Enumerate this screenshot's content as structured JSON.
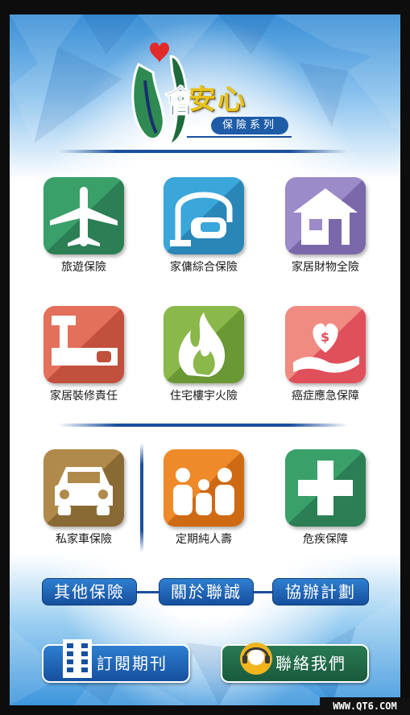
{
  "logo": {
    "title": "安心",
    "subtitle": "保險系列",
    "brand_char": "會",
    "heart_color": "#e22a2a"
  },
  "tiles": [
    {
      "label": "旅遊保險",
      "icon": "airplane-icon",
      "color_a": "#3aa06a",
      "color_b": "#2c7e54"
    },
    {
      "label": "家傭綜合保險",
      "icon": "vacuum-cleaner-icon",
      "color_a": "#3aa6d9",
      "color_b": "#2a86b7"
    },
    {
      "label": "家居財物全險",
      "icon": "house-icon",
      "color_a": "#9c8bc9",
      "color_b": "#7a68aa"
    },
    {
      "label": "家居裝修責任",
      "icon": "hammer-saw-icon",
      "color_a": "#e2705a",
      "color_b": "#c1503c"
    },
    {
      "label": "住宅樓宇火險",
      "icon": "fire-icon",
      "color_a": "#8ab84a",
      "color_b": "#6a9834"
    },
    {
      "label": "癌症應急保障",
      "icon": "heart-hand-icon",
      "color_a": "#f08b82",
      "color_b": "#e0505a"
    },
    {
      "label": "私家車保險",
      "icon": "car-icon",
      "color_a": "#b08a4a",
      "color_b": "#8a6a34"
    },
    {
      "label": "定期純人壽",
      "icon": "family-icon",
      "color_a": "#ef8a2a",
      "color_b": "#cf6a14"
    },
    {
      "label": "危疾保障",
      "icon": "medical-cross-icon",
      "color_a": "#3aa06a",
      "color_b": "#2c7e54"
    }
  ],
  "pills": [
    {
      "label": "其他保險"
    },
    {
      "label": "關於聯誠"
    },
    {
      "label": "協辦計劃"
    }
  ],
  "bottom": {
    "subscribe_label": "訂閱期刊",
    "contact_label": "聯絡我們"
  },
  "watermark": "WWW.QT6.COM"
}
